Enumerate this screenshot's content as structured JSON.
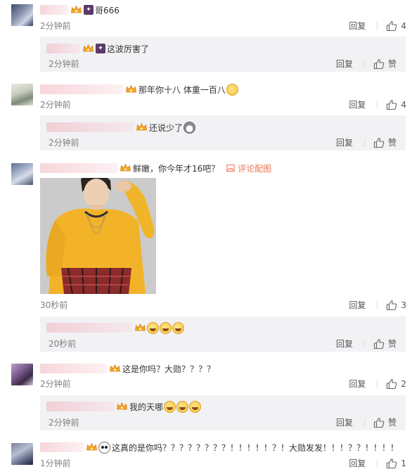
{
  "colors": {
    "accent_link": "#eb7350",
    "time_gray": "#808080",
    "sub_bg": "#f2f2f5",
    "vip_orange": "#f5a623"
  },
  "comments": [
    {
      "text": "哥666",
      "time": "2分钟前",
      "reply": "回复",
      "likes": "4",
      "sub": {
        "text": "这波厉害了",
        "time": "2分钟前",
        "reply": "回复",
        "like_label": "赞"
      }
    },
    {
      "text": "那年你十八 体重一百八",
      "time": "2分钟前",
      "reply": "回复",
      "likes": "4",
      "sub": {
        "text": "还说少了",
        "time": "2分钟前",
        "reply": "回复",
        "like_label": "赞"
      }
    },
    {
      "text": "鲜嫩，你今年才16吧？",
      "link_text": "评论配图",
      "time": "30秒前",
      "reply": "回复",
      "likes": "3",
      "sub": {
        "text": "",
        "time": "20秒前",
        "reply": "回复",
        "like_label": "赞"
      }
    },
    {
      "text": "这是你吗？大勋？？？？",
      "time": "2分钟前",
      "reply": "回复",
      "likes": "2",
      "sub": {
        "text": "我的天哪",
        "time": "2分钟前",
        "reply": "回复",
        "like_label": "赞"
      }
    },
    {
      "text": "这真的是你吗？？？？？？？？！！！！！？！大勋发发！！！？？！！！！",
      "time": "1分钟前",
      "reply": "回复",
      "likes": "1"
    }
  ],
  "icons": {
    "vip": "vip-crown-icon",
    "like": "thumbs-up-icon",
    "picture": "picture-icon"
  }
}
